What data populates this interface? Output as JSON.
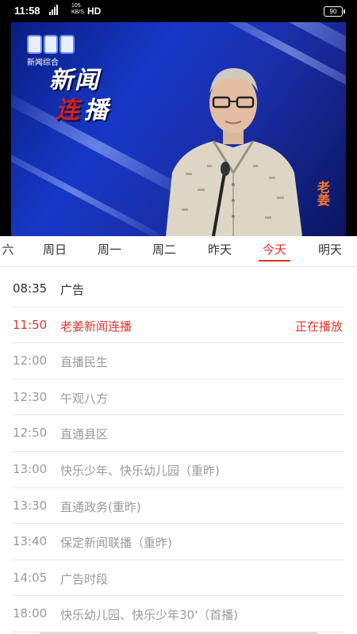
{
  "status_bar": {
    "time": "11:58",
    "speed_top": "105",
    "speed_bottom": "KB/S",
    "network": "HD",
    "battery": "90"
  },
  "video": {
    "channel_logo_text": "新闻综合",
    "title_line1": "新闻",
    "title_line2_a": "连",
    "title_line2_b": "播",
    "signature": "老姜"
  },
  "tabs": [
    {
      "label": "六",
      "active": false
    },
    {
      "label": "周日",
      "active": false
    },
    {
      "label": "周一",
      "active": false
    },
    {
      "label": "周二",
      "active": false
    },
    {
      "label": "昨天",
      "active": false
    },
    {
      "label": "今天",
      "active": true
    },
    {
      "label": "明天",
      "active": false
    }
  ],
  "programs": [
    {
      "time": "08:35",
      "name": "广告",
      "status": "",
      "state": "past"
    },
    {
      "time": "11:50",
      "name": "老姜新闻连播",
      "status": "正在播放",
      "state": "current"
    },
    {
      "time": "12:00",
      "name": "直播民生",
      "status": "",
      "state": "upcoming"
    },
    {
      "time": "12:30",
      "name": "午观八方",
      "status": "",
      "state": "upcoming"
    },
    {
      "time": "12:50",
      "name": "直通县区",
      "status": "",
      "state": "upcoming"
    },
    {
      "time": "13:00",
      "name": "快乐少年、快乐幼儿园（重昨)",
      "status": "",
      "state": "upcoming"
    },
    {
      "time": "13:30",
      "name": "直通政务(重昨)",
      "status": "",
      "state": "upcoming"
    },
    {
      "time": "13:40",
      "name": "保定新闻联播（重昨)",
      "status": "",
      "state": "upcoming"
    },
    {
      "time": "14:05",
      "name": "广告时段",
      "status": "",
      "state": "upcoming"
    },
    {
      "time": "18:00",
      "name": "快乐幼儿园、快乐少年30'（首播)",
      "status": "",
      "state": "upcoming"
    }
  ],
  "colors": {
    "accent": "#e0302b",
    "past_text": "#2e2e2e",
    "upcoming_text": "#9b9b9b"
  }
}
